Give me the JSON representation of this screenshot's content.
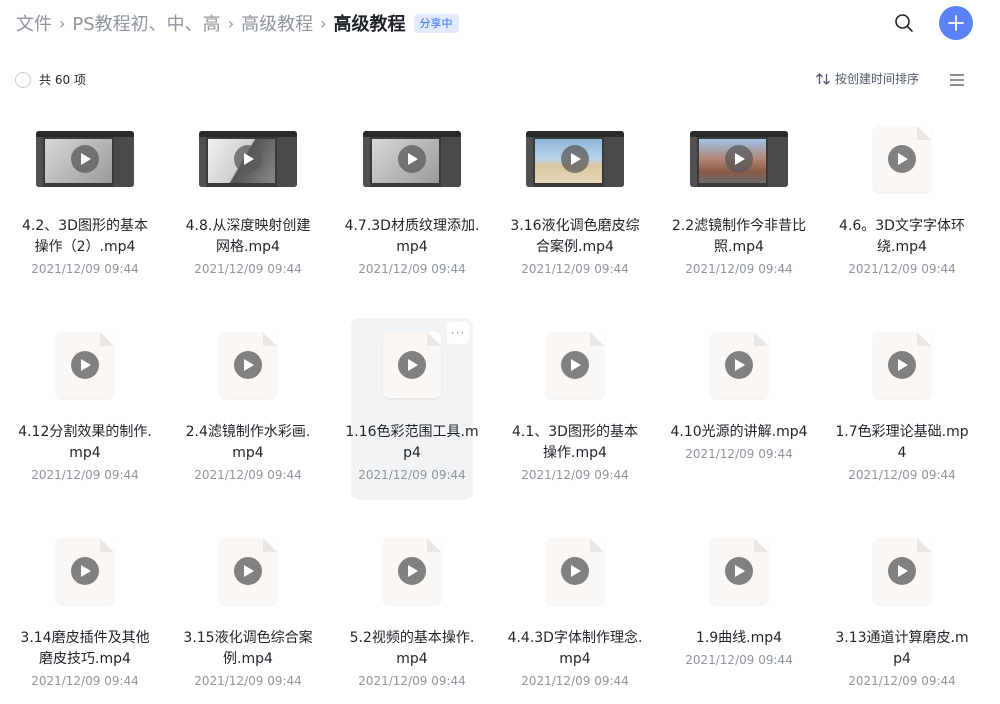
{
  "breadcrumb": {
    "items": [
      "文件",
      "PS教程初、中、高",
      "高级教程"
    ],
    "current": "高级教程",
    "badge": "分享中",
    "separator": "›"
  },
  "toolbar": {
    "count_label": "共 60 项",
    "sort_label": "按创建时间排序"
  },
  "icons": {
    "search": "search-icon",
    "add": "plus-icon",
    "sort": "sort-arrows-icon",
    "menu": "list-view-icon",
    "play": "play-icon"
  },
  "colors": {
    "accent": "#5b82f6",
    "badge_text": "#3370ff",
    "badge_bg": "#e1eaff",
    "muted": "#8f959e"
  },
  "files": [
    {
      "name": "4.2、3D图形的基本操作（2）.mp4",
      "date": "2021/12/09 09:44",
      "thumb": "video"
    },
    {
      "name": "4.8.从深度映射创建网格.mp4",
      "date": "2021/12/09 09:44",
      "thumb": "video-dark3d"
    },
    {
      "name": "4.7.3D材质纹理添加.mp4",
      "date": "2021/12/09 09:44",
      "thumb": "video"
    },
    {
      "name": "3.16液化调色磨皮综合案例.mp4",
      "date": "2021/12/09 09:44",
      "thumb": "video-beach"
    },
    {
      "name": "2.2滤镜制作今非昔比照.mp4",
      "date": "2021/12/09 09:44",
      "thumb": "video-street"
    },
    {
      "name": "4.6。3D文字字体环绕.mp4",
      "date": "2021/12/09 09:44",
      "thumb": "doc"
    },
    {
      "name": "4.12分割效果的制作.mp4",
      "date": "2021/12/09 09:44",
      "thumb": "doc"
    },
    {
      "name": "2.4滤镜制作水彩画.mp4",
      "date": "2021/12/09 09:44",
      "thumb": "doc"
    },
    {
      "name": "1.16色彩范围工具.mp4",
      "date": "2021/12/09 09:44",
      "thumb": "doc",
      "hovered": true,
      "more": "···"
    },
    {
      "name": "4.1、3D图形的基本操作.mp4",
      "date": "2021/12/09 09:44",
      "thumb": "doc"
    },
    {
      "name": "4.10光源的讲解.mp4",
      "date": "2021/12/09 09:44",
      "thumb": "doc"
    },
    {
      "name": "1.7色彩理论基础.mp4",
      "date": "2021/12/09 09:44",
      "thumb": "doc"
    },
    {
      "name": "3.14磨皮插件及其他磨皮技巧.mp4",
      "date": "2021/12/09 09:44",
      "thumb": "doc"
    },
    {
      "name": "3.15液化调色综合案例.mp4",
      "date": "2021/12/09 09:44",
      "thumb": "doc"
    },
    {
      "name": "5.2视频的基本操作.mp4",
      "date": "2021/12/09 09:44",
      "thumb": "doc"
    },
    {
      "name": "4.4.3D字体制作理念.mp4",
      "date": "2021/12/09 09:44",
      "thumb": "doc"
    },
    {
      "name": "1.9曲线.mp4",
      "date": "2021/12/09 09:44",
      "thumb": "doc"
    },
    {
      "name": "3.13通道计算磨皮.mp4",
      "date": "2021/12/09 09:44",
      "thumb": "doc"
    }
  ]
}
